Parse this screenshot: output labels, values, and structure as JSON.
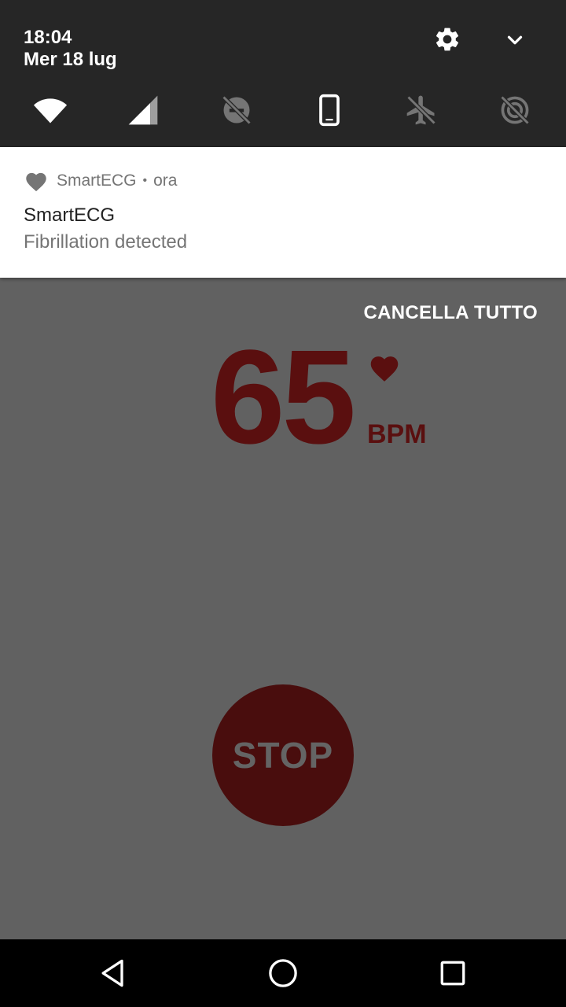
{
  "quick_settings": {
    "time": "18:04",
    "date": "Mer 18 lug",
    "icons": [
      "settings-icon",
      "chevron-down-icon"
    ],
    "tiles": [
      "wifi-icon",
      "cellular-signal-icon",
      "dnd-off-icon",
      "portrait-rotation-icon",
      "airplane-mode-off-icon",
      "location-off-icon"
    ]
  },
  "notification": {
    "app_name": "SmartECG",
    "separator": "•",
    "time": "ora",
    "title": "SmartECG",
    "text": "Fibrillation detected",
    "icon": "heart-icon"
  },
  "clear_all_label": "CANCELLA TUTTO",
  "heart_rate": {
    "value": "65",
    "unit": "BPM",
    "icon": "heart-icon",
    "color": "#5a0f0f"
  },
  "stop_button": {
    "label": "STOP",
    "color": "#490d0d"
  },
  "navigation": {
    "icons": [
      "back-icon",
      "home-icon",
      "recents-icon"
    ]
  }
}
